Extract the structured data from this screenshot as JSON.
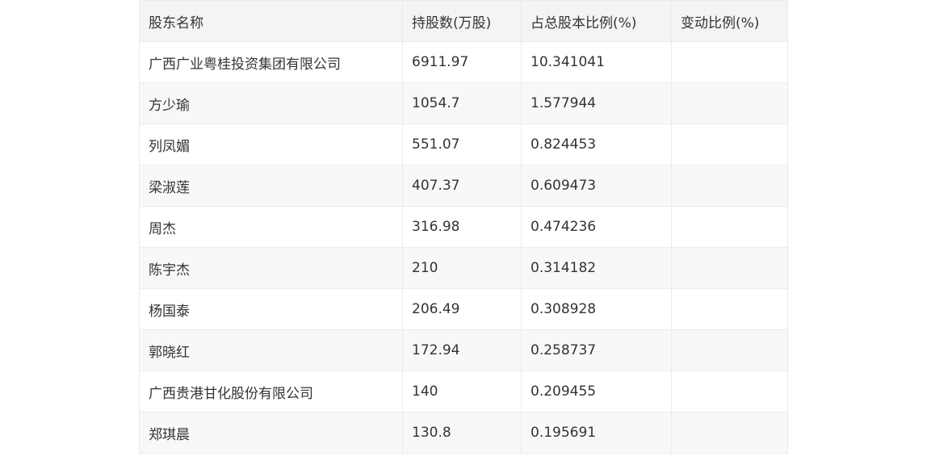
{
  "table": {
    "headers": [
      "股东名称",
      "持股数(万股)",
      "占总股本比例(%)",
      "变动比例(%)"
    ],
    "rows": [
      [
        "广西广业粤桂投资集团有限公司",
        "6911.97",
        "10.341041",
        ""
      ],
      [
        "方少瑜",
        "1054.7",
        "1.577944",
        ""
      ],
      [
        "列凤媚",
        "551.07",
        "0.824453",
        ""
      ],
      [
        "梁淑莲",
        "407.37",
        "0.609473",
        ""
      ],
      [
        "周杰",
        "316.98",
        "0.474236",
        ""
      ],
      [
        "陈宇杰",
        "210",
        "0.314182",
        ""
      ],
      [
        "杨国泰",
        "206.49",
        "0.308928",
        ""
      ],
      [
        "郭晓红",
        "172.94",
        "0.258737",
        ""
      ],
      [
        "广西贵港甘化股份有限公司",
        "140",
        "0.209455",
        ""
      ],
      [
        "郑琪晨",
        "130.8",
        "0.195691",
        ""
      ]
    ]
  }
}
